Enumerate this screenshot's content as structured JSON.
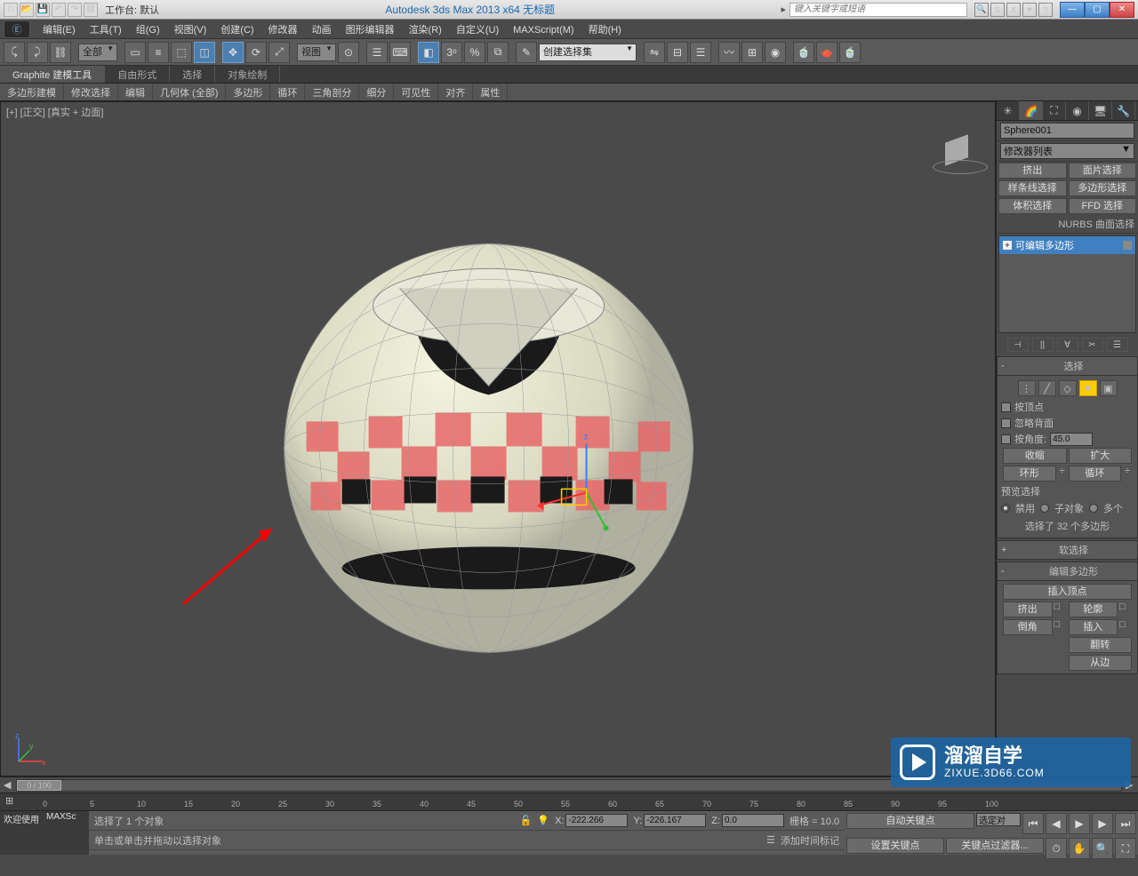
{
  "titlebar": {
    "workspace_label": "工作台: 默认",
    "app_title": "Autodesk 3ds Max  2013 x64     无标题",
    "search_placeholder": "键入关键字或短语"
  },
  "menus": [
    "编辑(E)",
    "工具(T)",
    "组(G)",
    "视图(V)",
    "创建(C)",
    "修改器",
    "动画",
    "图形编辑器",
    "渲染(R)",
    "自定义(U)",
    "MAXScript(M)",
    "帮助(H)"
  ],
  "toolbar": {
    "filter": "全部",
    "view_combo": "视图",
    "selset_combo": "创建选择集"
  },
  "ribbon": {
    "tabs": [
      "Graphite 建模工具",
      "自由形式",
      "选择",
      "对象绘制"
    ],
    "sub": [
      "多边形建模",
      "修改选择",
      "编辑",
      "几何体 (全部)",
      "多边形",
      "循环",
      "三角剖分",
      "细分",
      "可见性",
      "对齐",
      "属性"
    ]
  },
  "viewport": {
    "label": "[+] [正交] [真实 + 边面]"
  },
  "cmdpanel": {
    "objname": "Sphere001",
    "modlist_label": "修改器列表",
    "buttons_row1": [
      "挤出",
      "面片选择"
    ],
    "buttons_row2": [
      "样条线选择",
      "多边形选择"
    ],
    "buttons_row3": [
      "体积选择",
      "FFD 选择"
    ],
    "nurbs_label": "NURBS 曲面选择",
    "modstack_item": "可编辑多边形",
    "selection_hdr": "选择",
    "by_vertex": "按顶点",
    "ignore_backface": "忽略背面",
    "by_angle": "按角度:",
    "angle_val": "45.0",
    "shrink": "收缩",
    "expand": "扩大",
    "ring": "环形",
    "loop": "循环",
    "preview_label": "预览选择",
    "prev_off": "禁用",
    "prev_sub": "子对象",
    "prev_multi": "多个",
    "sel_count": "选择了 32 个多边形",
    "softsel_hdr": "软选择",
    "editpoly_hdr": "编辑多边形",
    "insert_vertex": "插入顶点",
    "extrude": "挤出",
    "outline": "轮廓",
    "bevel": "倒角",
    "insert": "插入",
    "flip": "翻转",
    "from_edge": "从边"
  },
  "timeline": {
    "frame": "0 / 100",
    "ticks": [
      0,
      5,
      10,
      15,
      20,
      25,
      30,
      35,
      40,
      45,
      50,
      55,
      60,
      65,
      70,
      75,
      80,
      85,
      90,
      95,
      100
    ]
  },
  "status": {
    "welcome": "欢迎使用",
    "maxscript": "MAXSc",
    "sel_info": "选择了 1 个对象",
    "prompt": "单击或单击并拖动以选择对象",
    "x": "-222.266",
    "y": "-226.167",
    "z": "0.0",
    "grid": "栅格 = 10.0",
    "addtime": "添加时间标记",
    "autokey": "自动关键点",
    "selset": "选定对",
    "setkey": "设置关键点",
    "keyfilter": "关键点过滤器..."
  },
  "watermark": {
    "cn": "溜溜自学",
    "url": "ZIXUE.3D66.COM"
  }
}
